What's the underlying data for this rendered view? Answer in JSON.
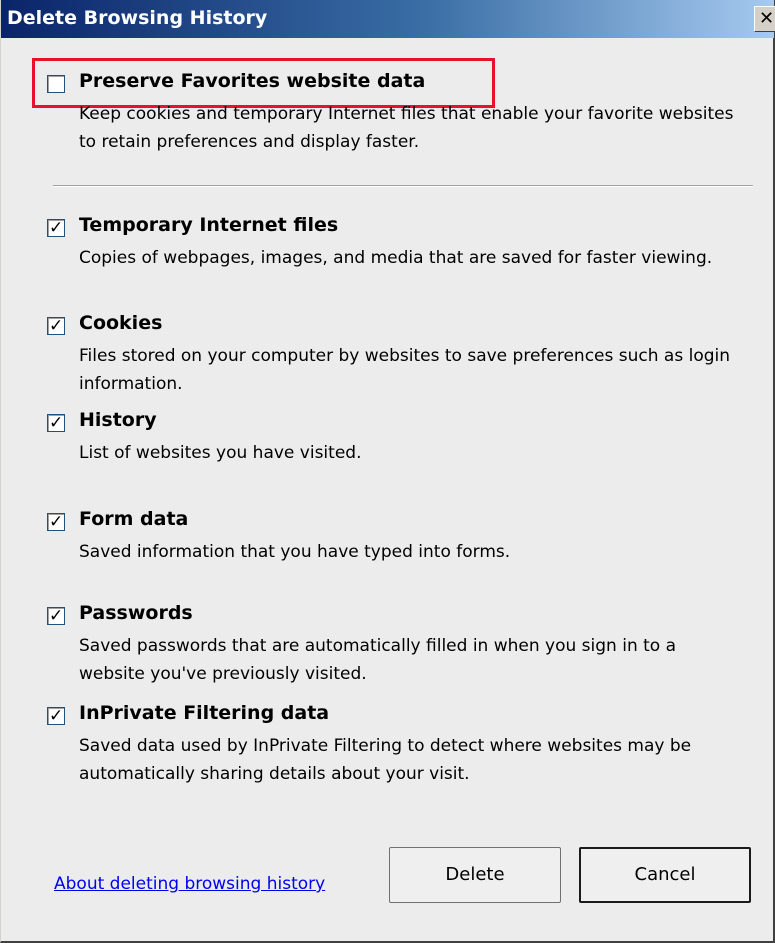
{
  "window": {
    "title": "Delete Browsing History",
    "close_glyph": "✕"
  },
  "highlight_color": "#e8102a",
  "options": [
    {
      "label": "Preserve Favorites website data",
      "description": "Keep cookies and temporary Internet files that enable your favorite websites to retain preferences and display faster.",
      "checked": false
    },
    {
      "label": "Temporary Internet files",
      "description": "Copies of webpages, images, and media that are saved for faster viewing.",
      "checked": true
    },
    {
      "label": "Cookies",
      "description": "Files stored on your computer by websites to save preferences such as login information.",
      "checked": true
    },
    {
      "label": "History",
      "description": "List of websites you have visited.",
      "checked": true
    },
    {
      "label": "Form data",
      "description": "Saved information that you have typed into forms.",
      "checked": true
    },
    {
      "label": "Passwords",
      "description": "Saved passwords that are automatically filled in when you sign in to a website you've previously visited.",
      "checked": true
    },
    {
      "label": "InPrivate Filtering data",
      "description": "Saved data used by InPrivate Filtering to detect where websites may be automatically sharing details about your visit.",
      "checked": true
    }
  ],
  "footer": {
    "about_link": "About deleting browsing history",
    "delete_label": "Delete",
    "cancel_label": "Cancel"
  }
}
